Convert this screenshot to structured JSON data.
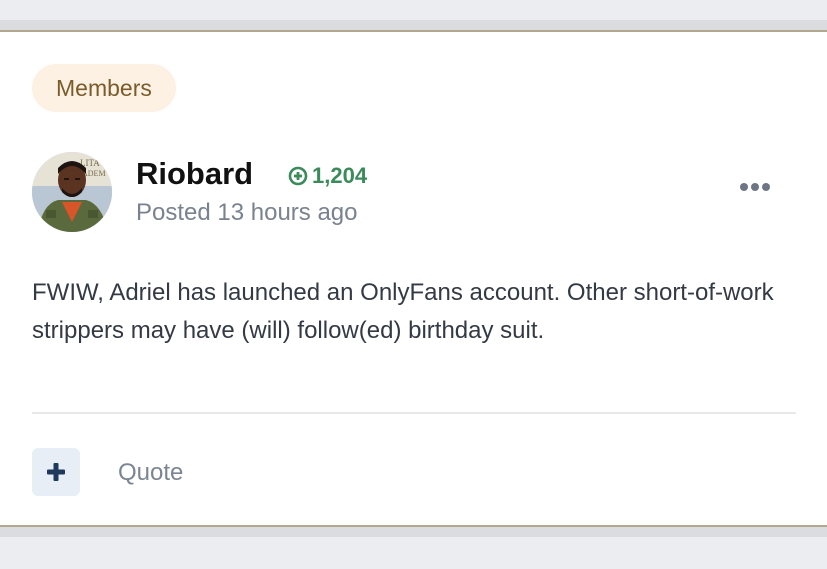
{
  "post": {
    "group_badge": "Members",
    "author": {
      "name": "Riobard",
      "reputation": "1,204",
      "reputation_icon": "plus-circle-icon",
      "avatar_icon": "user-avatar"
    },
    "meta": {
      "prefix": "Posted ",
      "time": "13 hours ago"
    },
    "menu_icon": "more-options-icon",
    "body": "FWIW, Adriel has launched an OnlyFans account. Other short-of-work strippers may have (will) follow(ed) birthday suit.",
    "actions": {
      "reputation_button_icon": "plus-icon",
      "quote_label": "Quote"
    }
  },
  "colors": {
    "badge_bg": "#fcf1e3",
    "badge_text": "#7a5c2c",
    "reputation_green": "#3b8a59",
    "card_border": "#b3a78d",
    "plus_button_bg": "#e7eef6",
    "plus_button_icon": "#1f3a5c"
  }
}
